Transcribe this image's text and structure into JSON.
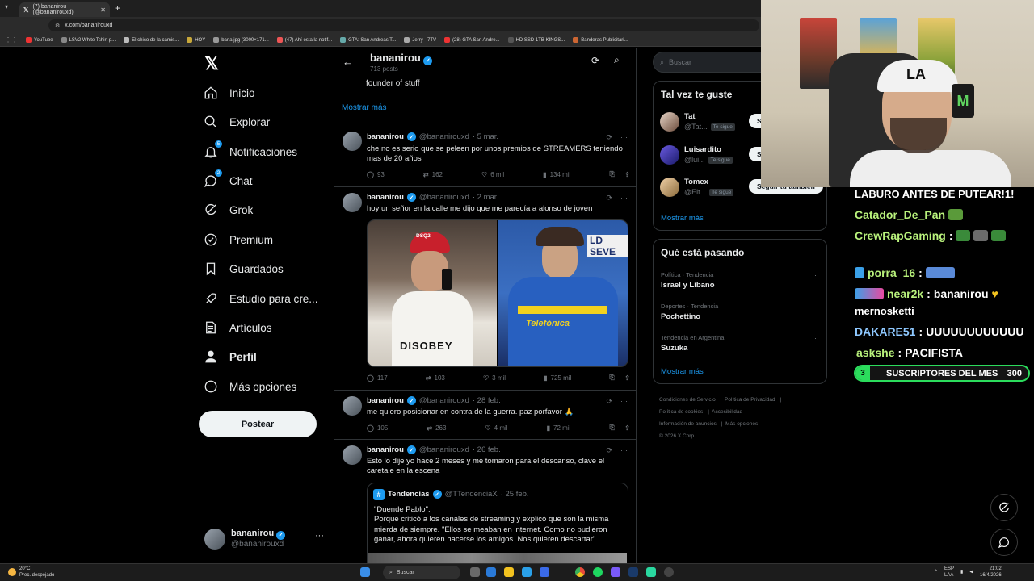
{
  "browser": {
    "tab_title": "(7) bananirou (@bananirouxd)",
    "url": "x.com/bananirouxd",
    "bookmarks": [
      "YouTube",
      "LSV2 White Tshirt p...",
      "El chico de la camis...",
      "HOY",
      "bana.jpg (3000×171...",
      "(47) Ahí esta la notif...",
      "GTA: San Andreas T...",
      "Jerry - 7TV",
      "(28) GTA San Andre...",
      "HD SSD 1TB KINGS...",
      "Banderas Publicitari..."
    ]
  },
  "nav": {
    "items": [
      "Inicio",
      "Explorar",
      "Notificaciones",
      "Chat",
      "Grok",
      "Premium",
      "Guardados",
      "Estudio para cre...",
      "Artículos",
      "Perfil",
      "Más opciones"
    ],
    "notif_badge": "5",
    "chat_badge": "2",
    "post_button": "Postear",
    "account_name": "bananirou",
    "account_handle": "@bananirouxd"
  },
  "profile_header": {
    "name": "bananirou",
    "posts": "713 posts"
  },
  "bio": {
    "text": "founder of stuff",
    "more": "Mostrar más"
  },
  "tweets": [
    {
      "name": "bananirou",
      "handle": "@bananirouxd",
      "date": "· 5 mar.",
      "text": "che no es serio que se peleen por unos premios de STREAMERS teniendo mas de 20 años",
      "replies": "93",
      "reposts": "162",
      "likes": "6 mil",
      "views": "134 mil"
    },
    {
      "name": "bananirou",
      "handle": "@bananirouxd",
      "date": "· 2 mar.",
      "text": "hoy un señor en la calle me dijo que me parecía a alonso de joven",
      "replies": "117",
      "reposts": "103",
      "likes": "3 mil",
      "views": "725 mil"
    },
    {
      "name": "bananirou",
      "handle": "@bananirouxd",
      "date": "· 28 feb.",
      "text": "me quiero posicionar en contra de la guerra. paz porfavor 🙏",
      "replies": "105",
      "reposts": "263",
      "likes": "4 mil",
      "views": "72 mil"
    },
    {
      "name": "bananirou",
      "handle": "@bananirouxd",
      "date": "· 26 feb.",
      "text": "Esto lo dije yo hace 2 meses y me tomaron para el descanso, clave el caretaje en la escena"
    }
  ],
  "quote": {
    "name": "Tendencias",
    "handle": "@TTendenciaX",
    "date": "· 25 feb.",
    "text_title": "\"Duende Pablo\":",
    "text_body": "Porque criticó a los canales de streaming y explicó que son la misma mierda de siempre. \"Ellos se meaban en internet. Como no pudieron ganar, ahora quieren hacerse los amigos. Nos quieren descartar\"."
  },
  "image_text": {
    "cap": "DSQ2",
    "shirt": "DISOBEY",
    "sponsor": "Telefónica",
    "banner": "LD SEVE"
  },
  "sidebar": {
    "search_placeholder": "Buscar",
    "suggest_title": "Tal vez te guste",
    "suggestions": [
      {
        "name": "Tat",
        "handle": "@Tat...",
        "tag": "Te sigue",
        "btn": "Seg"
      },
      {
        "name": "Luisardito",
        "handle": "@lui...",
        "tag": "Te sigue",
        "btn": "Seg"
      },
      {
        "name": "Tomex",
        "handle": "@Elt...",
        "tag": "Te sigue",
        "btn": "Seguir tú también"
      }
    ],
    "suggest_more": "Mostrar más",
    "trends_title": "Qué está pasando",
    "trends": [
      {
        "cat": "Política · Tendencia",
        "topic": "Israel y Líbano"
      },
      {
        "cat": "Deportes · Tendencia",
        "topic": "Pochettino"
      },
      {
        "cat": "Tendencia en Argentina",
        "topic": "Suzuka"
      }
    ],
    "trends_more": "Mostrar más",
    "footer": [
      "Condiciones de Servicio",
      "Política de Privacidad",
      "Política de cookies",
      "Accesibilidad",
      "Información de anuncios",
      "Más opciones ···",
      "© 2026 X Corp."
    ]
  },
  "stream": {
    "cap_logo": "LA",
    "chat": [
      {
        "user": "",
        "text": "LABURO ANTES DE PUTEAR!1!"
      },
      {
        "user": "Catador_De_Pan",
        "text": ""
      },
      {
        "user": "CrewRapGaming",
        "text": ""
      },
      {
        "user": "porra_16",
        "text": ""
      },
      {
        "user": "near2k",
        "text": "bananirou"
      },
      {
        "user": "",
        "text": "mernosketti"
      },
      {
        "user": "DAKARE51",
        "text": "UUUUUUUUUUUU"
      },
      {
        "user": "askshe",
        "text": "PACIFISTA"
      }
    ],
    "sub_count": "3",
    "sub_label": "SUSCRIPTORES DEL MES",
    "sub_goal": "300"
  },
  "taskbar": {
    "temp": "20°C",
    "weather": "Prec. despejado",
    "search": "Buscar",
    "lang1": "ESP",
    "lang2": "LAA",
    "time": "21:02",
    "date": "16/4/2026"
  },
  "colors": {
    "accent": "#1d9bf0",
    "background": "#000000",
    "border": "#2f3336",
    "muted": "#71767b",
    "sub_green": "#2bdc5c"
  }
}
